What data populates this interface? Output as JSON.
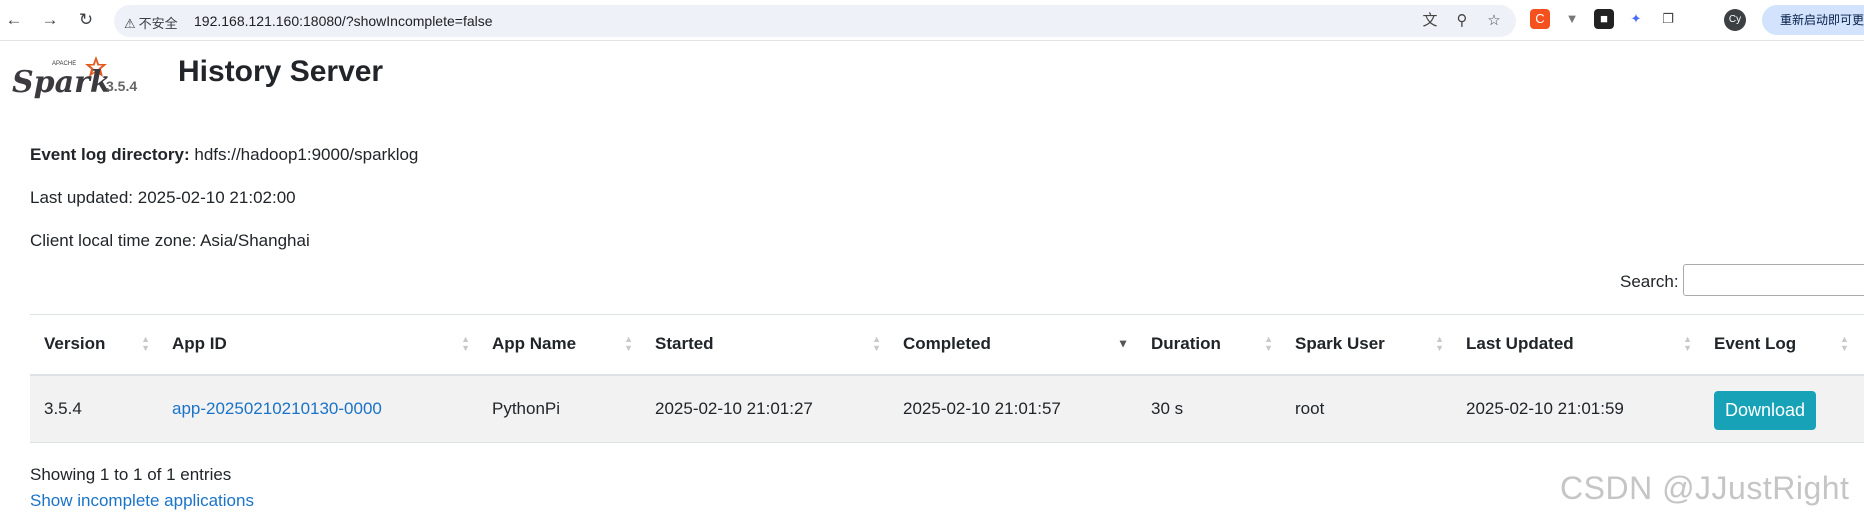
{
  "browser": {
    "security_label": "不安全",
    "url": "192.168.121.160:18080/?showIncomplete=false",
    "profile_initials": "Cy",
    "restart_label": "重新启动即可更新"
  },
  "header": {
    "logo_version": "3.5.4",
    "title": "History Server"
  },
  "info": {
    "event_log_label": "Event log directory:",
    "event_log_value": "hdfs://hadoop1:9000/sparklog",
    "last_updated": "Last updated: 2025-02-10 21:02:00",
    "time_zone": "Client local time zone: Asia/Shanghai"
  },
  "search": {
    "label": "Search:",
    "value": ""
  },
  "table": {
    "columns": [
      "Version",
      "App ID",
      "App Name",
      "Started",
      "Completed",
      "Duration",
      "Spark User",
      "Last Updated",
      "Event Log"
    ],
    "sorted_column": "Completed",
    "sort_direction": "descending",
    "rows": [
      {
        "version": "3.5.4",
        "app_id": "app-20250210210130-0000",
        "app_name": "PythonPi",
        "started": "2025-02-10 21:01:27",
        "completed": "2025-02-10 21:01:57",
        "duration": "30 s",
        "spark_user": "root",
        "last_updated": "2025-02-10 21:01:59",
        "event_log": "Download"
      }
    ]
  },
  "footer": {
    "showing": "Showing 1 to 1 of 1 entries",
    "incomplete_link": "Show incomplete applications"
  },
  "watermark": "CSDN @JJustRight",
  "colors": {
    "accent": "#17a2b8",
    "link": "#1a73c8",
    "row_bg": "#f2f2f2"
  }
}
